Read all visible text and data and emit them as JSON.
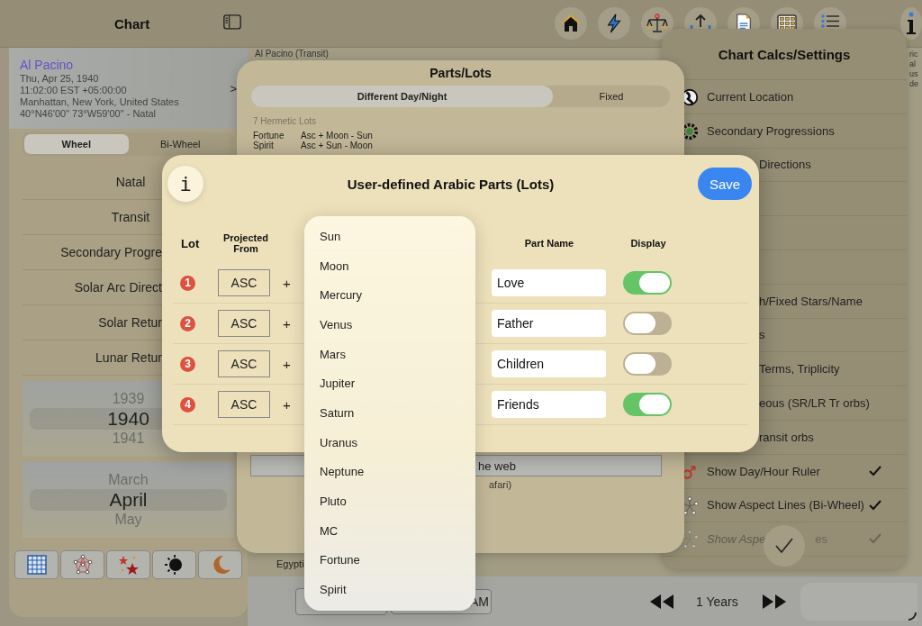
{
  "top_bar": {
    "title": "Chart"
  },
  "person": {
    "name": "Al Pacino",
    "lines": [
      "Thu, Apr 25, 1940",
      "11:02:00 EST +05:00:00",
      "Manhattan, New York, United States",
      "40°N46'00\" 73°W59'00\" - Natal"
    ],
    "chevron": ">"
  },
  "chart_type_tabs": [
    {
      "label": "Wheel",
      "selected": true
    },
    {
      "label": "Bi-Wheel",
      "selected": false
    }
  ],
  "chart_list": [
    {
      "label": "Natal",
      "kind": "full"
    },
    {
      "label": "Transit",
      "kind": "full"
    },
    {
      "label": "Secondary Progre",
      "kind": "cut"
    },
    {
      "label": "Solar Arc Direct",
      "kind": "cut"
    },
    {
      "label": "Solar Retur",
      "kind": "cut"
    },
    {
      "label": "Lunar Retur",
      "kind": "cut"
    }
  ],
  "year_picker": [
    {
      "label": "1939",
      "selected": false
    },
    {
      "label": "1940",
      "selected": true
    },
    {
      "label": "1941",
      "selected": false
    }
  ],
  "month_picker": [
    {
      "label": "March",
      "selected": false
    },
    {
      "label": "April",
      "selected": true
    },
    {
      "label": "May",
      "selected": false
    }
  ],
  "chart_view": {
    "title": "Al Pacino (Transit)",
    "place": "Egypti",
    "side_text": [
      "ric",
      "al",
      "us",
      "de"
    ]
  },
  "bottom_bar": {
    "time": "AM",
    "step": "1 Years"
  },
  "parts_panel": {
    "title": "Parts/Lots",
    "tabs": [
      {
        "label": "Different Day/Night",
        "selected": true
      },
      {
        "label": "Fixed",
        "selected": false
      }
    ],
    "section": "7 Hermetic Lots",
    "lots": [
      {
        "name": "Fortune",
        "formula": "Asc + Moon - Sun"
      },
      {
        "name": "Spirit",
        "formula": "Asc + Sun - Moon"
      }
    ],
    "web_button": "he web",
    "web_note": "afari)"
  },
  "settings_panel": {
    "title": "Chart Calcs/Settings",
    "items": [
      {
        "kind": "full",
        "label": "Current Location",
        "checked": false,
        "disabled": false
      },
      {
        "kind": "full",
        "label": "Secondary Progressions",
        "checked": false,
        "disabled": false
      },
      {
        "kind": "clipped",
        "label": "Directions",
        "checked": false,
        "disabled": false
      },
      {
        "kind": "covered",
        "checked": false
      },
      {
        "kind": "covered",
        "checked": false
      },
      {
        "kind": "covered",
        "checked": false
      },
      {
        "kind": "clipped",
        "label": "h/Fixed Stars/Name",
        "checked": false,
        "disabled": false
      },
      {
        "kind": "clipped",
        "label": "s",
        "checked": false,
        "disabled": false
      },
      {
        "kind": "clipped",
        "label": "Terms, Triplicity",
        "checked": false,
        "disabled": false
      },
      {
        "kind": "clipped",
        "label": "eous (SR/LR Tr orbs)",
        "checked": false,
        "disabled": false
      },
      {
        "kind": "clipped",
        "label": "ransit orbs",
        "checked": false,
        "disabled": false
      },
      {
        "kind": "full",
        "label": "Show Day/Hour Ruler",
        "checked": true,
        "disabled": false
      },
      {
        "kind": "full",
        "label": "Show Aspect Lines (Bi-Wheel)",
        "checked": true,
        "disabled": false
      },
      {
        "kind": "split",
        "label": "Show Aspe",
        "tail": "es",
        "checked": true,
        "disabled": true
      }
    ]
  },
  "lots_dialog": {
    "info": "i",
    "title": "User-defined Arabic Parts (Lots)",
    "save": "Save",
    "columns": [
      "Lot",
      "Projected From",
      "Part Name",
      "Display"
    ],
    "rows": [
      {
        "number": "1",
        "from": "ASC",
        "plus": "+",
        "name": "Love",
        "on": true
      },
      {
        "number": "2",
        "from": "ASC",
        "plus": "+",
        "name": "Father",
        "on": false
      },
      {
        "number": "3",
        "from": "ASC",
        "plus": "+",
        "name": "Children",
        "on": false
      },
      {
        "number": "4",
        "from": "ASC",
        "plus": "+",
        "name": "Friends",
        "on": true
      }
    ]
  },
  "planet_menu": [
    "Sun",
    "Moon",
    "Mercury",
    "Venus",
    "Mars",
    "Jupiter",
    "Saturn",
    "Uranus",
    "Neptune",
    "Pluto",
    "MC",
    "Fortune",
    "Spirit"
  ]
}
